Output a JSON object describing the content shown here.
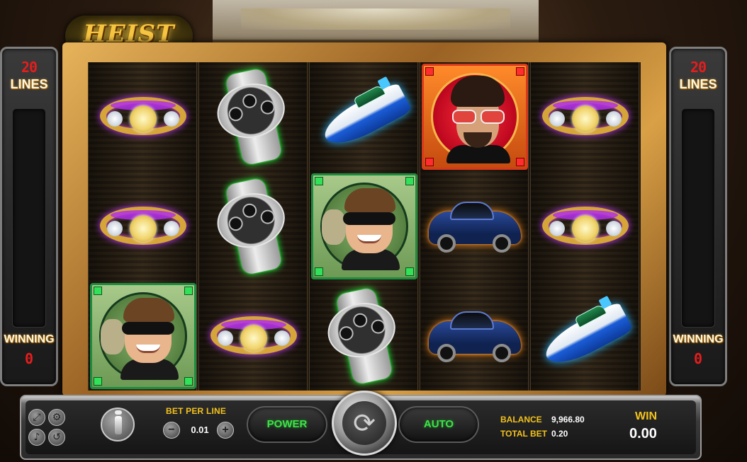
{
  "game": {
    "title": "HEIST"
  },
  "left_panel": {
    "lines_value": "20",
    "lines_label": "LINES",
    "winning_label": "WINNING",
    "winning_value": "0"
  },
  "right_panel": {
    "lines_value": "20",
    "lines_label": "LINES",
    "winning_label": "WINNING",
    "winning_value": "0"
  },
  "reels": [
    [
      "ring",
      "ring",
      "thief"
    ],
    [
      "watch",
      "watch",
      "ring"
    ],
    [
      "boat",
      "thief",
      "watch"
    ],
    [
      "boss",
      "car",
      "car"
    ],
    [
      "ring",
      "ring",
      "boat"
    ]
  ],
  "controls": {
    "icons": [
      "fullscreen-icon",
      "settings-icon",
      "sound-off-icon",
      "history-icon"
    ],
    "bet_per_line_label": "BET PER LINE",
    "bet_per_line_value": "0.01",
    "minus_label": "−",
    "plus_label": "+",
    "power_label": "POWER",
    "auto_label": "AUTO",
    "spin_glyph": "⟳",
    "balance_label": "BALANCE",
    "balance_value": "9,966.80",
    "total_bet_label": "TOTAL BET",
    "total_bet_value": "0.20",
    "win_label": "WIN",
    "win_value": "0.00"
  }
}
